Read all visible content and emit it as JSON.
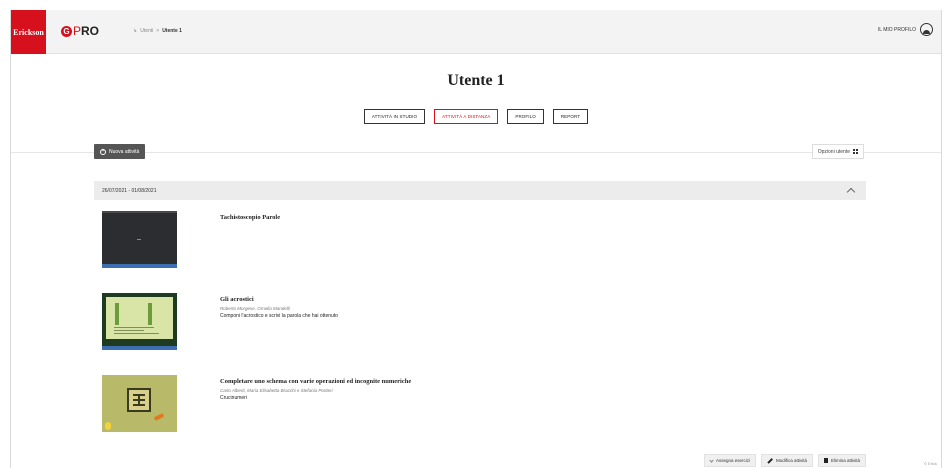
{
  "header": {
    "brand_erickson": "Erickson",
    "brand_gpro_letter": "G",
    "brand_gpro_p": "P",
    "brand_gpro_ro": "RO",
    "breadcrumb": {
      "arrow": "↳",
      "parent": "Utenti",
      "separator": ">",
      "current": "Utente 1"
    },
    "profile_label": "IL MIO PROFILO"
  },
  "page": {
    "title": "Utente 1",
    "tabs": [
      {
        "label": "ATTIVITÀ IN STUDIO",
        "active": false
      },
      {
        "label": "ATTIVITÀ A DISTANZA",
        "active": true
      },
      {
        "label": "PROFILO",
        "active": false
      },
      {
        "label": "REPORT",
        "active": false
      }
    ]
  },
  "toolbar": {
    "new_activity_icon": "plus-circle-icon",
    "new_activity_label": "Nuova attività",
    "user_options_label": "Opzioni utente",
    "user_options_icon": "grid-icon"
  },
  "panel": {
    "date_range": "26/07/2021 - 01/08/2021",
    "activities": [
      {
        "title": "Tachistoscopio Parole",
        "authors": "",
        "description": ""
      },
      {
        "title": "Gli acrostici",
        "authors": "Roberto Morgese, Ornella Mandelli",
        "description": "Componi l'acrostico e scrivi la parola che hai ottenuto"
      },
      {
        "title": "Completare uno schema con varie operazioni ed incognite numeriche",
        "authors": "Carlo Alberti, Maria Elisabetta Bracchi e Stefania Portieri",
        "description": "Crucinumeri"
      }
    ],
    "actions": {
      "assign": "Assegna esercizi",
      "edit": "Modifica attività",
      "delete": "Elimina attività"
    }
  },
  "colors": {
    "brand_red": "#d6101d",
    "header_bg": "#f3f3f3",
    "new_activity_bg": "#555555"
  },
  "footer": {
    "corner": "© Erick"
  }
}
